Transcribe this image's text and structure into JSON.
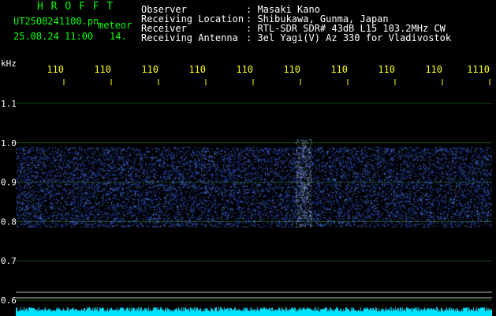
{
  "header": {
    "app_name": "H R O F F T",
    "filename": "UT2508241100.pn",
    "mode": "meteor",
    "datetime": "25.08.24 11:00",
    "count": "14.",
    "info": [
      {
        "label": "Observer",
        "value": ": Masaki Kano"
      },
      {
        "label": "Receiving Location",
        "value": ": Shibukawa, Gunma, Japan"
      },
      {
        "label": "Receiver",
        "value": ": RTL-SDR SDR# 43dB L15 103.2MHz CW"
      },
      {
        "label": "Receiving Antenna",
        "value": ": 3el Yagi(V) Az 330 for Vladivostok"
      }
    ]
  },
  "chart_data": {
    "type": "heatmap",
    "y_unit": "kHz",
    "y_ticks": [
      "1.1",
      "1.0",
      "0.9",
      "0.8",
      "0.7",
      "0.6"
    ],
    "y_values": [
      1.1,
      1.0,
      0.9,
      0.8,
      0.7,
      0.6
    ],
    "ylim": [
      0.6,
      1.1
    ],
    "x_ticks": [
      "110",
      "110",
      "110",
      "110",
      "110",
      "110",
      "110",
      "110",
      "110",
      "1110"
    ],
    "signal_band_khz": [
      0.8,
      1.0
    ],
    "colors": {
      "background": "#000000",
      "grid": "#1a4a1a",
      "noise": "#2a4cff",
      "tick": "#ffff00",
      "baseline": "#00e0ff"
    }
  }
}
